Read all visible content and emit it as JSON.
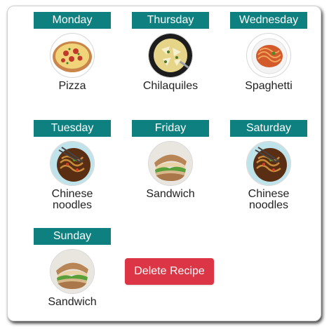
{
  "days": [
    {
      "day": "Monday",
      "food": "Pizza",
      "icon": "pizza-icon"
    },
    {
      "day": "Thursday",
      "food": "Chilaquiles",
      "icon": "chilaquiles-icon"
    },
    {
      "day": "Wednesday",
      "food": "Spaghetti",
      "icon": "spaghetti-icon"
    },
    {
      "day": "Tuesday",
      "food": "Chinese noodles",
      "icon": "noodles-icon"
    },
    {
      "day": "Friday",
      "food": "Sandwich",
      "icon": "sandwich-icon"
    },
    {
      "day": "Saturday",
      "food": "Chinese noodles",
      "icon": "noodles-icon"
    },
    {
      "day": "Sunday",
      "food": "Sandwich",
      "icon": "sandwich-icon"
    }
  ],
  "delete_button": {
    "label": "Delete Recipe"
  },
  "colors": {
    "day_header": "#0e8080",
    "delete_button": "#dc3545"
  }
}
